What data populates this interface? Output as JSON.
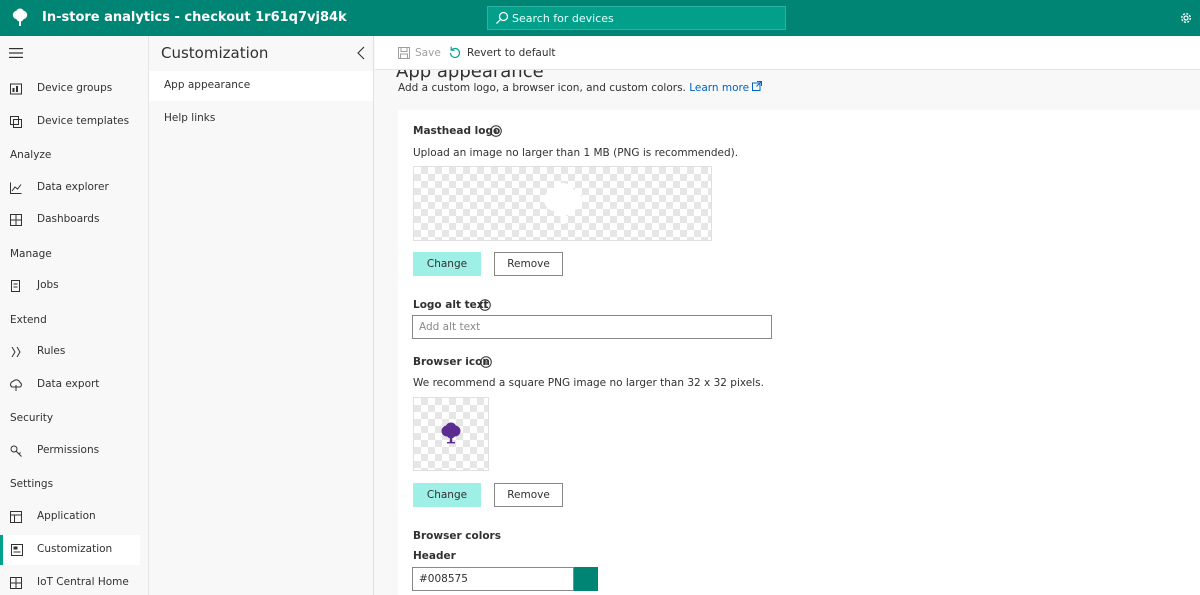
{
  "app": {
    "title": "In-store analytics - checkout 1r61q7vj84k",
    "brand_color": "#008575"
  },
  "search": {
    "placeholder": "Search for devices"
  },
  "nav": {
    "items": [
      {
        "label": "Device groups",
        "icon": "device-groups-icon"
      },
      {
        "label": "Device templates",
        "icon": "device-templates-icon"
      },
      {
        "label": "Data explorer",
        "icon": "data-explorer-icon"
      },
      {
        "label": "Dashboards",
        "icon": "dashboards-icon"
      },
      {
        "label": "Jobs",
        "icon": "jobs-icon"
      },
      {
        "label": "Rules",
        "icon": "rules-icon"
      },
      {
        "label": "Data export",
        "icon": "data-export-icon"
      },
      {
        "label": "Permissions",
        "icon": "permissions-icon"
      },
      {
        "label": "Application",
        "icon": "application-icon"
      },
      {
        "label": "Customization",
        "icon": "customization-icon",
        "active": true
      },
      {
        "label": "IoT Central Home",
        "icon": "iot-central-home-icon"
      }
    ],
    "sections": [
      "Analyze",
      "Manage",
      "Extend",
      "Security",
      "Settings"
    ]
  },
  "panel": {
    "title": "Customization",
    "items": [
      {
        "label": "App appearance",
        "active": true
      },
      {
        "label": "Help links"
      }
    ]
  },
  "toolbar": {
    "save_label": "Save",
    "revert_label": "Revert to default"
  },
  "content": {
    "heading": "App appearance",
    "description": "Add a custom logo, a browser icon, and custom colors.",
    "learn_more": "Learn more",
    "masthead": {
      "label": "Masthead logo",
      "help": "Upload an image no larger than 1 MB (PNG is recommended).",
      "change_label": "Change",
      "remove_label": "Remove"
    },
    "alt_text": {
      "label": "Logo alt text",
      "placeholder": "Add alt text"
    },
    "browser_icon": {
      "label": "Browser icon",
      "help": "We recommend a square PNG image no larger than 32 x 32 pixels.",
      "change_label": "Change",
      "remove_label": "Remove",
      "icon_color": "#5c2d91"
    },
    "colors": {
      "label": "Browser colors",
      "header_label": "Header",
      "header_value": "#008575"
    }
  }
}
